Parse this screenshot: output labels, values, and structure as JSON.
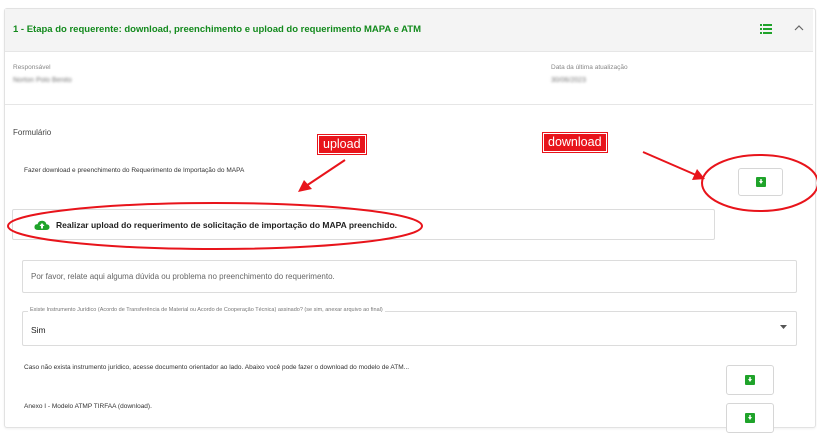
{
  "header": {
    "title": "1 - Etapa do requerente: download, preenchimento e upload do requerimento MAPA e ATM"
  },
  "meta": {
    "responsible_label": "Responsável",
    "responsible_value": "Norton Polo Benito",
    "updated_label": "Data da última atualização",
    "updated_value": "30/06/2023"
  },
  "form": {
    "section_title": "Formulário",
    "download_prompt": "Fazer download e preenchimento do Requerimento de Importação do MAPA",
    "upload_label": "Realizar upload do requerimento de solicitação de importação do MAPA preenchido.",
    "question_placeholder": "Por favor, relate aqui alguma dúvida ou problema no preenchimento do requerimento.",
    "select_label": "Existe Instrumento Jurídico (Acordo de Transferência de Material ou Acordo de Cooperação Técnica) assinado? (se sim, anexar arquivo ao final)",
    "select_value": "Sim",
    "atm_note": "Caso não exista instrumento jurídico, acesse documento orientador ao lado. Abaixo você pode fazer o download do modelo de ATM...",
    "annex_label": "Anexo I - Modelo ATMP TIRFAA (download)."
  },
  "annotations": {
    "upload": "upload",
    "download": "download"
  },
  "colors": {
    "title_green": "#138a1d",
    "icon_green": "#1fa32a",
    "annotation_red": "#e8141b"
  }
}
